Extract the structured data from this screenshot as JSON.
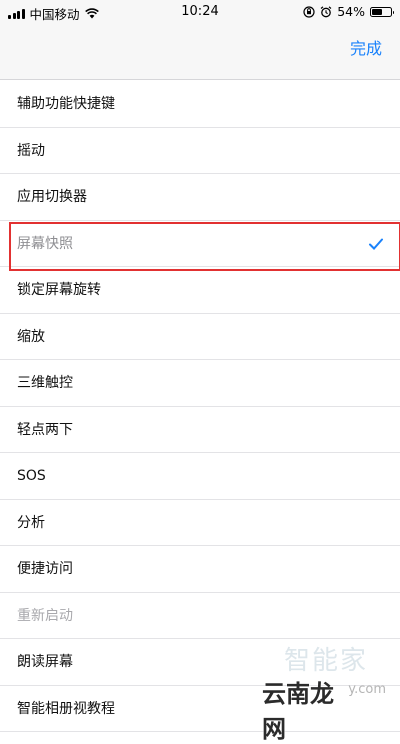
{
  "status_bar": {
    "carrier": "中国移动",
    "time": "10:24",
    "battery_percent": "54%",
    "battery_level": 0.54,
    "icons": [
      "signal-icon",
      "wifi-icon",
      "orientation-lock-icon",
      "alarm-icon",
      "battery-icon"
    ]
  },
  "nav": {
    "done_label": "完成"
  },
  "items": [
    {
      "label": "辅助功能快捷键"
    },
    {
      "label": "摇动"
    },
    {
      "label": "应用切换器"
    },
    {
      "label": "屏幕快照",
      "selected": true
    },
    {
      "label": "锁定屏幕旋转"
    },
    {
      "label": "缩放"
    },
    {
      "label": "三维触控"
    },
    {
      "label": "轻点两下"
    },
    {
      "label": "SOS"
    },
    {
      "label": "分析"
    },
    {
      "label": "便捷访问"
    },
    {
      "label": "重新启动",
      "disabled": true
    },
    {
      "label": "朗读屏幕"
    },
    {
      "label": "智能相册视教程"
    }
  ],
  "watermark": {
    "top_text": "智能家",
    "bottom_text": "云南龙网",
    "small_text": "y.com"
  },
  "colors": {
    "accent": "#1a82fb",
    "highlight_border": "#e23131",
    "disabled_text": "#a9a9ad"
  }
}
